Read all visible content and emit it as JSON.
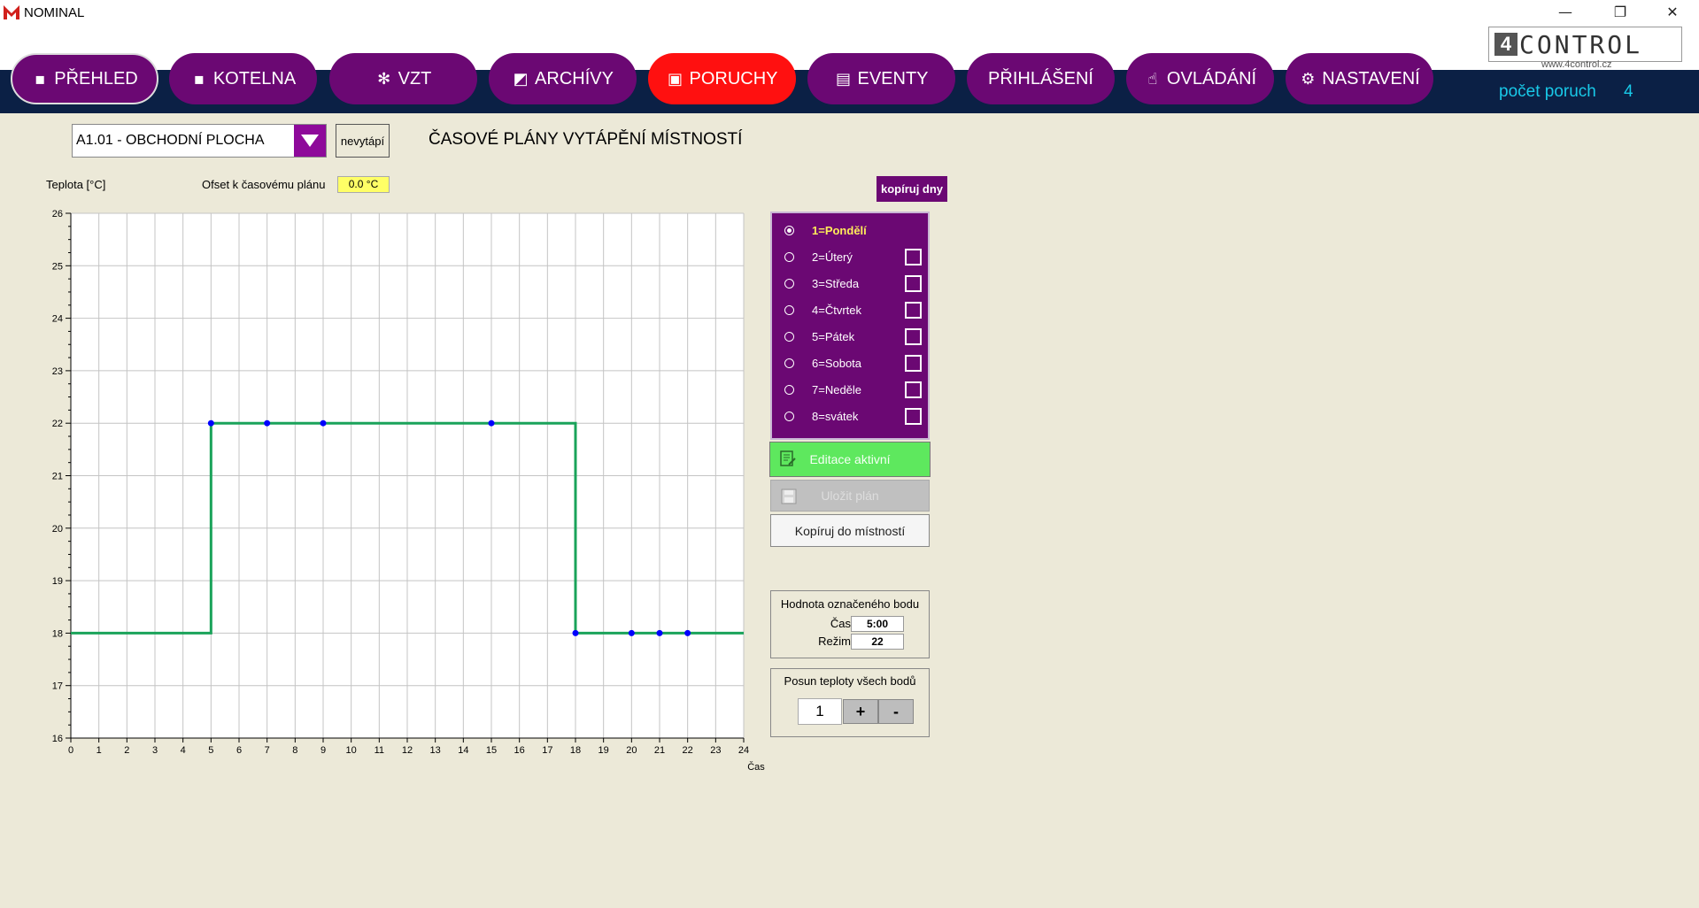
{
  "window": {
    "title": "NOMINAL",
    "minimize": "—",
    "restore": "❐",
    "close": "✕"
  },
  "nav": [
    {
      "label": "PŘEHLED",
      "icon": "overview-icon",
      "glyph": "▪"
    },
    {
      "label": "KOTELNA",
      "icon": "boiler-icon",
      "glyph": "▪"
    },
    {
      "label": "VZT",
      "icon": "snowflake-icon",
      "glyph": "✻"
    },
    {
      "label": "ARCHÍVY",
      "icon": "chart-icon",
      "glyph": "◩"
    },
    {
      "label": "PORUCHY",
      "icon": "alarm-icon",
      "glyph": "▣"
    },
    {
      "label": "EVENTY",
      "icon": "list-icon",
      "glyph": "▤"
    },
    {
      "label": "PŘIHLÁŠENÍ",
      "icon": "",
      "glyph": ""
    },
    {
      "label": "OVLÁDÁNÍ",
      "icon": "hand-icon",
      "glyph": "☝"
    },
    {
      "label": "NASTAVENÍ",
      "icon": "gear-icon",
      "glyph": "⚙"
    }
  ],
  "brand": {
    "mark": "4",
    "name": "CONTROL",
    "url": "www.4control.cz"
  },
  "faults": {
    "label": "počet poruch",
    "count": "4"
  },
  "toolbar": {
    "room": "A1.01 - OBCHODNÍ PLOCHA",
    "nevytapi": "nevytápí",
    "title": "ČASOVÉ PLÁNY VYTÁPĚNÍ MÍSTNOSTÍ"
  },
  "chart_meta": {
    "offset_label": "Ofset k časovému plánu",
    "offset_value": "0.0 °C"
  },
  "chart_data": {
    "type": "line",
    "ylabel": "Teplota [°C]",
    "xlabel": "Čas",
    "xlim": [
      0,
      24
    ],
    "ylim": [
      16,
      26
    ],
    "grid": true,
    "x_ticks": [
      0,
      1,
      2,
      3,
      4,
      5,
      6,
      7,
      8,
      9,
      10,
      11,
      12,
      13,
      14,
      15,
      16,
      17,
      18,
      19,
      20,
      21,
      22,
      23,
      24
    ],
    "y_ticks": [
      16,
      17,
      18,
      19,
      20,
      21,
      22,
      23,
      24,
      25,
      26
    ],
    "line_color": "#1aa35a",
    "marker_color": "#0000ff",
    "series": [
      {
        "step_x": [
          0,
          5,
          5,
          18,
          18,
          24
        ],
        "step_y": [
          18,
          18,
          22,
          22,
          18,
          18
        ],
        "points": [
          [
            5,
            22
          ],
          [
            7,
            22
          ],
          [
            9,
            22
          ],
          [
            15,
            22
          ],
          [
            18,
            18
          ],
          [
            20,
            18
          ],
          [
            21,
            18
          ],
          [
            22,
            18
          ]
        ]
      }
    ]
  },
  "days": {
    "copy_label": "kopíruj dny",
    "items": [
      {
        "label": "1=Pondělí",
        "selected": true
      },
      {
        "label": "2=Úterý",
        "selected": false
      },
      {
        "label": "3=Středa",
        "selected": false
      },
      {
        "label": "4=Čtvrtek",
        "selected": false
      },
      {
        "label": "5=Pátek",
        "selected": false
      },
      {
        "label": "6=Sobota",
        "selected": false
      },
      {
        "label": "7=Neděle",
        "selected": false
      },
      {
        "label": "8=svátek",
        "selected": false
      }
    ]
  },
  "actions": {
    "edit": "Editace aktivní",
    "save": "Uložit plán",
    "copy": "Kopíruj do místností"
  },
  "point": {
    "title": "Hodnota označeného bodu",
    "time_label": "Čas",
    "time_value": "5:00",
    "mode_label": "Režim",
    "mode_value": "22"
  },
  "shift": {
    "title": "Posun teploty všech bodů",
    "value": "1",
    "plus": "+",
    "minus": "-"
  },
  "colors": {
    "nav_bg": "#6b0873",
    "alarm": "#ff1010",
    "band": "#0b2045",
    "accent": "#19c9e8",
    "edit_active": "#5ee85e"
  }
}
